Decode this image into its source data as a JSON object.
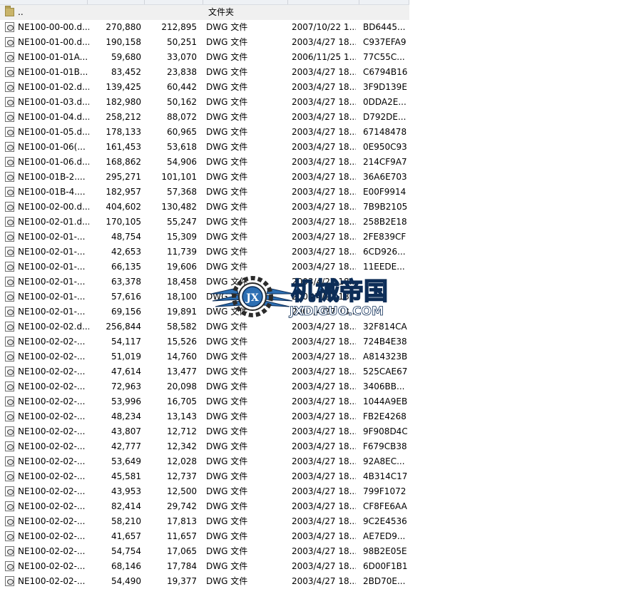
{
  "parent_row": {
    "name": "..",
    "type": "文件夹",
    "icon": "folder-icon"
  },
  "file_icon": "dwg-file-icon",
  "rows": [
    {
      "name": "NE100-00-00.d...",
      "size": "270,880",
      "packed": "212,895",
      "type": "DWG 文件",
      "modified": "2007/10/22 1...",
      "crc": "BD6445..."
    },
    {
      "name": "NE100-01-00.d...",
      "size": "190,158",
      "packed": "50,251",
      "type": "DWG 文件",
      "modified": "2003/4/27 18...",
      "crc": "C937EFA9"
    },
    {
      "name": "NE100-01-01A...",
      "size": "59,680",
      "packed": "33,070",
      "type": "DWG 文件",
      "modified": "2006/11/25 1...",
      "crc": "77C55C..."
    },
    {
      "name": "NE100-01-01B...",
      "size": "83,452",
      "packed": "23,838",
      "type": "DWG 文件",
      "modified": "2003/4/27 18...",
      "crc": "C6794B16"
    },
    {
      "name": "NE100-01-02.d...",
      "size": "139,425",
      "packed": "60,442",
      "type": "DWG 文件",
      "modified": "2003/4/27 18...",
      "crc": "3F9D139E"
    },
    {
      "name": "NE100-01-03.d...",
      "size": "182,980",
      "packed": "50,162",
      "type": "DWG 文件",
      "modified": "2003/4/27 18...",
      "crc": "0DDA2E..."
    },
    {
      "name": "NE100-01-04.d...",
      "size": "258,212",
      "packed": "88,072",
      "type": "DWG 文件",
      "modified": "2003/4/27 18...",
      "crc": "D792DE..."
    },
    {
      "name": "NE100-01-05.d...",
      "size": "178,133",
      "packed": "60,965",
      "type": "DWG 文件",
      "modified": "2003/4/27 18...",
      "crc": "67148478"
    },
    {
      "name": "NE100-01-06(...",
      "size": "161,453",
      "packed": "53,618",
      "type": "DWG 文件",
      "modified": "2003/4/27 18...",
      "crc": "0E950C93"
    },
    {
      "name": "NE100-01-06.d...",
      "size": "168,862",
      "packed": "54,906",
      "type": "DWG 文件",
      "modified": "2003/4/27 18...",
      "crc": "214CF9A7"
    },
    {
      "name": "NE100-01B-2....",
      "size": "295,271",
      "packed": "101,101",
      "type": "DWG 文件",
      "modified": "2003/4/27 18...",
      "crc": "36A6E703"
    },
    {
      "name": "NE100-01B-4....",
      "size": "182,957",
      "packed": "57,368",
      "type": "DWG 文件",
      "modified": "2003/4/27 18...",
      "crc": "E00F9914"
    },
    {
      "name": "NE100-02-00.d...",
      "size": "404,602",
      "packed": "130,482",
      "type": "DWG 文件",
      "modified": "2003/4/27 18...",
      "crc": "7B9B2105"
    },
    {
      "name": "NE100-02-01.d...",
      "size": "170,105",
      "packed": "55,247",
      "type": "DWG 文件",
      "modified": "2003/4/27 18...",
      "crc": "258B2E18"
    },
    {
      "name": "NE100-02-01-...",
      "size": "48,754",
      "packed": "15,309",
      "type": "DWG 文件",
      "modified": "2003/4/27 18...",
      "crc": "2FE839CF"
    },
    {
      "name": "NE100-02-01-...",
      "size": "42,653",
      "packed": "11,739",
      "type": "DWG 文件",
      "modified": "2003/4/27 18...",
      "crc": "6CD926..."
    },
    {
      "name": "NE100-02-01-...",
      "size": "66,135",
      "packed": "19,606",
      "type": "DWG 文件",
      "modified": "2003/4/27 18...",
      "crc": "11EEDE..."
    },
    {
      "name": "NE100-02-01-...",
      "size": "63,378",
      "packed": "18,458",
      "type": "DWG 文件",
      "modified": "2003/4/27 18...",
      "crc": ""
    },
    {
      "name": "NE100-02-01-...",
      "size": "57,616",
      "packed": "18,100",
      "type": "DWG 文件",
      "modified": "2003/4/27 18...",
      "crc": ""
    },
    {
      "name": "NE100-02-01-...",
      "size": "69,156",
      "packed": "19,891",
      "type": "DWG 文件",
      "modified": "2003/4/27 18...",
      "crc": ""
    },
    {
      "name": "NE100-02-02.d...",
      "size": "256,844",
      "packed": "58,582",
      "type": "DWG 文件",
      "modified": "2003/4/27 18...",
      "crc": "32F814CA"
    },
    {
      "name": "NE100-02-02-...",
      "size": "54,117",
      "packed": "15,526",
      "type": "DWG 文件",
      "modified": "2003/4/27 18...",
      "crc": "724B4E38"
    },
    {
      "name": "NE100-02-02-...",
      "size": "51,019",
      "packed": "14,760",
      "type": "DWG 文件",
      "modified": "2003/4/27 18...",
      "crc": "A814323B"
    },
    {
      "name": "NE100-02-02-...",
      "size": "47,614",
      "packed": "13,477",
      "type": "DWG 文件",
      "modified": "2003/4/27 18...",
      "crc": "525CAE67"
    },
    {
      "name": "NE100-02-02-...",
      "size": "72,963",
      "packed": "20,098",
      "type": "DWG 文件",
      "modified": "2003/4/27 18...",
      "crc": "3406BB..."
    },
    {
      "name": "NE100-02-02-...",
      "size": "53,996",
      "packed": "16,705",
      "type": "DWG 文件",
      "modified": "2003/4/27 18...",
      "crc": "1044A9EB"
    },
    {
      "name": "NE100-02-02-...",
      "size": "48,234",
      "packed": "13,143",
      "type": "DWG 文件",
      "modified": "2003/4/27 18...",
      "crc": "FB2E4268"
    },
    {
      "name": "NE100-02-02-...",
      "size": "43,807",
      "packed": "12,712",
      "type": "DWG 文件",
      "modified": "2003/4/27 18...",
      "crc": "9F908D4C"
    },
    {
      "name": "NE100-02-02-...",
      "size": "42,777",
      "packed": "12,342",
      "type": "DWG 文件",
      "modified": "2003/4/27 18...",
      "crc": "F679CB38"
    },
    {
      "name": "NE100-02-02-...",
      "size": "53,649",
      "packed": "12,028",
      "type": "DWG 文件",
      "modified": "2003/4/27 18...",
      "crc": "92A8EC..."
    },
    {
      "name": "NE100-02-02-...",
      "size": "45,581",
      "packed": "12,737",
      "type": "DWG 文件",
      "modified": "2003/4/27 18...",
      "crc": "4B314C17"
    },
    {
      "name": "NE100-02-02-...",
      "size": "43,953",
      "packed": "12,500",
      "type": "DWG 文件",
      "modified": "2003/4/27 18...",
      "crc": "799F1072"
    },
    {
      "name": "NE100-02-02-...",
      "size": "82,414",
      "packed": "29,742",
      "type": "DWG 文件",
      "modified": "2003/4/27 18...",
      "crc": "CF8FE6AA"
    },
    {
      "name": "NE100-02-02-...",
      "size": "58,210",
      "packed": "17,813",
      "type": "DWG 文件",
      "modified": "2003/4/27 18...",
      "crc": "9C2E4536"
    },
    {
      "name": "NE100-02-02-...",
      "size": "41,657",
      "packed": "11,657",
      "type": "DWG 文件",
      "modified": "2003/4/27 18...",
      "crc": "AE7ED9..."
    },
    {
      "name": "NE100-02-02-...",
      "size": "54,754",
      "packed": "17,065",
      "type": "DWG 文件",
      "modified": "2003/4/27 18...",
      "crc": "98B2E05E"
    },
    {
      "name": "NE100-02-02-...",
      "size": "68,146",
      "packed": "17,784",
      "type": "DWG 文件",
      "modified": "2003/4/27 18...",
      "crc": "6D00F1B1"
    },
    {
      "name": "NE100-02-02-...",
      "size": "54,490",
      "packed": "19,377",
      "type": "DWG 文件",
      "modified": "2003/4/27 18...",
      "crc": "2BD70E..."
    }
  ],
  "watermark": {
    "emblem_text": "JX",
    "title": "机械帝国",
    "url": "JXDIGUO.COM",
    "colors": {
      "primary": "#2d6fb3",
      "outline": "#0d2d57"
    }
  },
  "colors": {
    "parent_row_bg": "#f0f0f0",
    "header_strip_bg": "#eef1f5"
  }
}
